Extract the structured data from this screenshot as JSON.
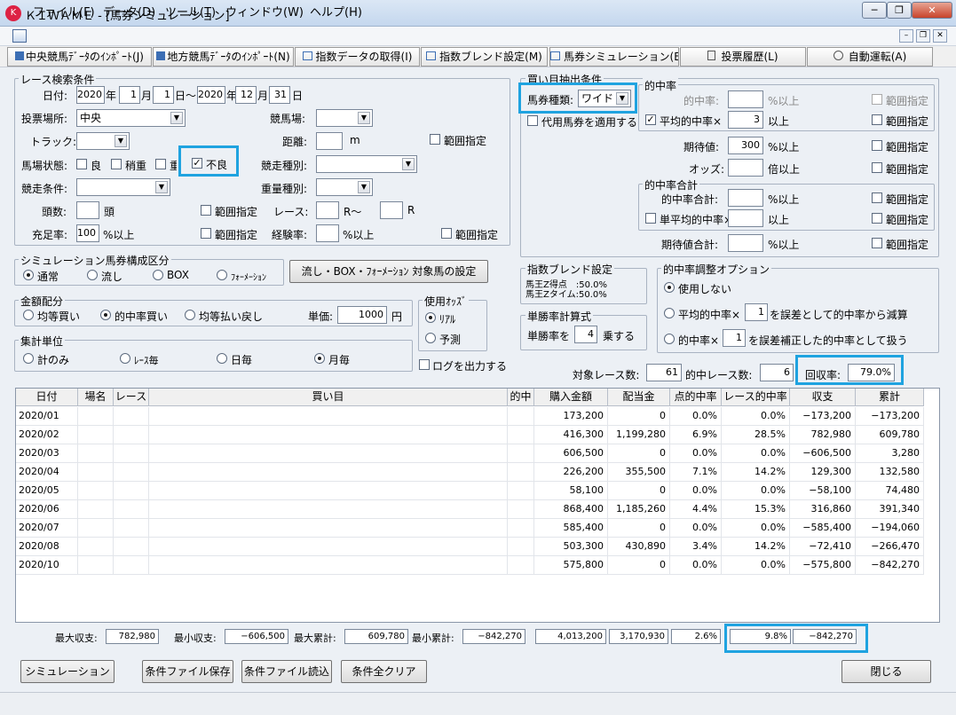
{
  "window": {
    "title": "ＫＩＷＡＭＥ - [馬券シミュレーション]",
    "icon": "app-logo-icon",
    "controls": {
      "minimize": "─",
      "restore": "❐",
      "close": "✕"
    }
  },
  "menu": {
    "items": [
      "ファイル(F)",
      "データ(D)",
      "ツール(T)",
      "ウィンドウ(W)",
      "ヘルプ(H)"
    ],
    "mdi": {
      "minimize": "–",
      "restore": "❐",
      "close": "✕"
    }
  },
  "toolbar": {
    "buttons": [
      {
        "label": "中央競馬ﾃﾞｰﾀのｲﾝﾎﾟｰﾄ(J)",
        "icon": "import-icon"
      },
      {
        "label": "地方競馬ﾃﾞｰﾀのｲﾝﾎﾟｰﾄ(N)",
        "icon": "import-icon"
      },
      {
        "label": "指数データの取得(I)",
        "icon": "table-icon"
      },
      {
        "label": "指数ブレンド設定(M)",
        "icon": "table-icon"
      },
      {
        "label": "馬券シミュレーション(B)",
        "icon": "table-icon"
      },
      {
        "label": "投票履歴(L)",
        "icon": "document-icon"
      },
      {
        "label": "自動運転(A)",
        "icon": "clock-icon"
      }
    ]
  },
  "race_search": {
    "title": "レース検索条件",
    "date_label": "日付:",
    "from_year": "2020",
    "year_unit": "年",
    "from_month": "1",
    "month_unit": "月",
    "from_day": "1",
    "day_tilde": "日～",
    "to_year": "2020",
    "to_month": "12",
    "to_day": "31",
    "day_unit": "日",
    "venue_label": "投票場所:",
    "venue_value": "中央",
    "track_label": "競馬場:",
    "track_value": "",
    "surface_label": "トラック:",
    "surface_value": "",
    "distance_label": "距離:",
    "distance_value": "",
    "distance_unit": "m",
    "distance_range": "範囲指定",
    "condition_label": "馬場状態:",
    "conditions": [
      {
        "label": "良",
        "checked": false
      },
      {
        "label": "稍重",
        "checked": false
      },
      {
        "label": "重",
        "checked": false
      },
      {
        "label": "不良",
        "checked": true
      }
    ],
    "race_type_label": "競走種別:",
    "race_type_value": "",
    "race_cond_label": "競走条件:",
    "race_cond_value": "",
    "weight_label": "重量種別:",
    "weight_value": "",
    "heads_label": "頭数:",
    "heads_value": "",
    "heads_unit": "頭",
    "heads_range": "範囲指定",
    "race_label": "レース:",
    "race_from": "",
    "race_mid": "R～",
    "race_to": "",
    "race_unit": "R",
    "fill_label": "充足率:",
    "fill_value": "100",
    "fill_unit": "%以上",
    "fill_range": "範囲指定",
    "exp_label": "経験率:",
    "exp_value": "",
    "exp_unit": "%以上",
    "exp_range": "範囲指定"
  },
  "composition": {
    "title": "シミュレーション馬券構成区分",
    "options": [
      {
        "label": "通常",
        "selected": true
      },
      {
        "label": "流し",
        "selected": false
      },
      {
        "label": "BOX",
        "selected": false
      },
      {
        "label": "ﾌｫｰﾒｰｼｮﾝ",
        "selected": false
      }
    ],
    "button": "流し・BOX・ﾌｫｰﾒｰｼｮﾝ 対象馬の設定"
  },
  "allocation": {
    "title": "金額配分",
    "options": [
      {
        "label": "均等買い",
        "selected": false
      },
      {
        "label": "的中率買い",
        "selected": true
      },
      {
        "label": "均等払い戻し",
        "selected": false
      }
    ],
    "unit_label": "単価:",
    "unit_value": "1000",
    "unit_suffix": "円"
  },
  "odds": {
    "title": "使用ｵｯｽﾞ",
    "options": [
      {
        "label": "ﾘｱﾙ",
        "selected": true
      },
      {
        "label": "予測",
        "selected": false
      }
    ]
  },
  "aggregate": {
    "title": "集計単位",
    "options": [
      {
        "label": "計のみ",
        "selected": false
      },
      {
        "label": "ﾚｰｽ毎",
        "selected": false
      },
      {
        "label": "日毎",
        "selected": false
      },
      {
        "label": "月毎",
        "selected": true
      }
    ]
  },
  "log_output": {
    "label": "ログを出力する",
    "checked": false
  },
  "bet": {
    "title": "買い目抽出条件",
    "type_label": "馬券種類:",
    "type_value": "ワイド",
    "substitute_label": "代用馬券を適用する",
    "hit_group": "的中率",
    "hit_label": "的中率:",
    "hit_value": "",
    "hit_unit": "%以上",
    "hit_range": "範囲指定",
    "avg_label": "平均的中率×",
    "avg_value": "3",
    "avg_unit": "以上",
    "avg_range": "範囲指定",
    "avg_checked": true,
    "ev_label": "期待値:",
    "ev_value": "300",
    "ev_unit": "%以上",
    "ev_range": "範囲指定",
    "odds_label": "オッズ:",
    "odds_value": "",
    "odds_unit": "倍以上",
    "odds_range": "範囲指定",
    "sum_group": "的中率合計",
    "hitsum_label": "的中率合計:",
    "hitsum_value": "",
    "hitsum_unit": "%以上",
    "hitsum_range": "範囲指定",
    "single_label": "単平均的中率×",
    "single_value": "",
    "single_unit": "以上",
    "single_range": "範囲指定",
    "evsum_label": "期待値合計:",
    "evsum_value": "",
    "evsum_unit": "%以上",
    "evsum_range": "範囲指定"
  },
  "blend": {
    "title": "指数ブレンド設定",
    "lines": [
      "馬王Z得点　:50.0%",
      "馬王Zタイム:50.0%"
    ]
  },
  "win_rate": {
    "title": "単勝率計算式",
    "prefix": "単勝率を",
    "value": "4",
    "suffix": "乗する"
  },
  "adjust": {
    "title": "的中率調整オプション",
    "options": [
      {
        "label": "使用しない",
        "selected": true
      },
      {
        "prefix": "平均的中率×",
        "value": "1",
        "suffix": "を誤差として的中率から減算",
        "selected": false
      },
      {
        "prefix": "的中率×",
        "value": "1",
        "suffix": "を誤差補正した的中率として扱う",
        "selected": false
      }
    ]
  },
  "stats": {
    "races_label": "対象レース数:",
    "races_value": "61",
    "hits_label": "的中レース数:",
    "hits_value": "6",
    "recovery_label": "回収率:",
    "recovery_value": "79.0%"
  },
  "table": {
    "columns": [
      "日付",
      "場名",
      "レース",
      "買い目",
      "的中",
      "購入金額",
      "配当金",
      "点的中率",
      "レース的中率",
      "収支",
      "累計"
    ],
    "rows": [
      [
        "2020/01",
        "",
        "",
        "",
        "",
        "173,200",
        "0",
        "0.0%",
        "0.0%",
        "−173,200",
        "−173,200"
      ],
      [
        "2020/02",
        "",
        "",
        "",
        "",
        "416,300",
        "1,199,280",
        "6.9%",
        "28.5%",
        "782,980",
        "609,780"
      ],
      [
        "2020/03",
        "",
        "",
        "",
        "",
        "606,500",
        "0",
        "0.0%",
        "0.0%",
        "−606,500",
        "3,280"
      ],
      [
        "2020/04",
        "",
        "",
        "",
        "",
        "226,200",
        "355,500",
        "7.1%",
        "14.2%",
        "129,300",
        "132,580"
      ],
      [
        "2020/05",
        "",
        "",
        "",
        "",
        "58,100",
        "0",
        "0.0%",
        "0.0%",
        "−58,100",
        "74,480"
      ],
      [
        "2020/06",
        "",
        "",
        "",
        "",
        "868,400",
        "1,185,260",
        "4.4%",
        "15.3%",
        "316,860",
        "391,340"
      ],
      [
        "2020/07",
        "",
        "",
        "",
        "",
        "585,400",
        "0",
        "0.0%",
        "0.0%",
        "−585,400",
        "−194,060"
      ],
      [
        "2020/08",
        "",
        "",
        "",
        "",
        "503,300",
        "430,890",
        "3.4%",
        "14.2%",
        "−72,410",
        "−266,470"
      ],
      [
        "2020/10",
        "",
        "",
        "",
        "",
        "575,800",
        "0",
        "0.0%",
        "0.0%",
        "−575,800",
        "−842,270"
      ]
    ]
  },
  "summary": {
    "max_label": "最大収支:",
    "max_value": "782,980",
    "min_label": "最小収支:",
    "min_value": "−606,500",
    "maxcum_label": "最大累計:",
    "maxcum_value": "609,780",
    "mincum_label": "最小累計:",
    "mincum_value": "−842,270",
    "purchase": "4,013,200",
    "payout": "3,170,930",
    "point_hit": "2.6%",
    "race_hit": "9.8%",
    "balance": "−842,270"
  },
  "buttons": {
    "simulate": "シミュレーション",
    "save": "条件ファイル保存",
    "load": "条件ファイル読込",
    "clear": "条件全クリア",
    "close": "閉じる"
  }
}
